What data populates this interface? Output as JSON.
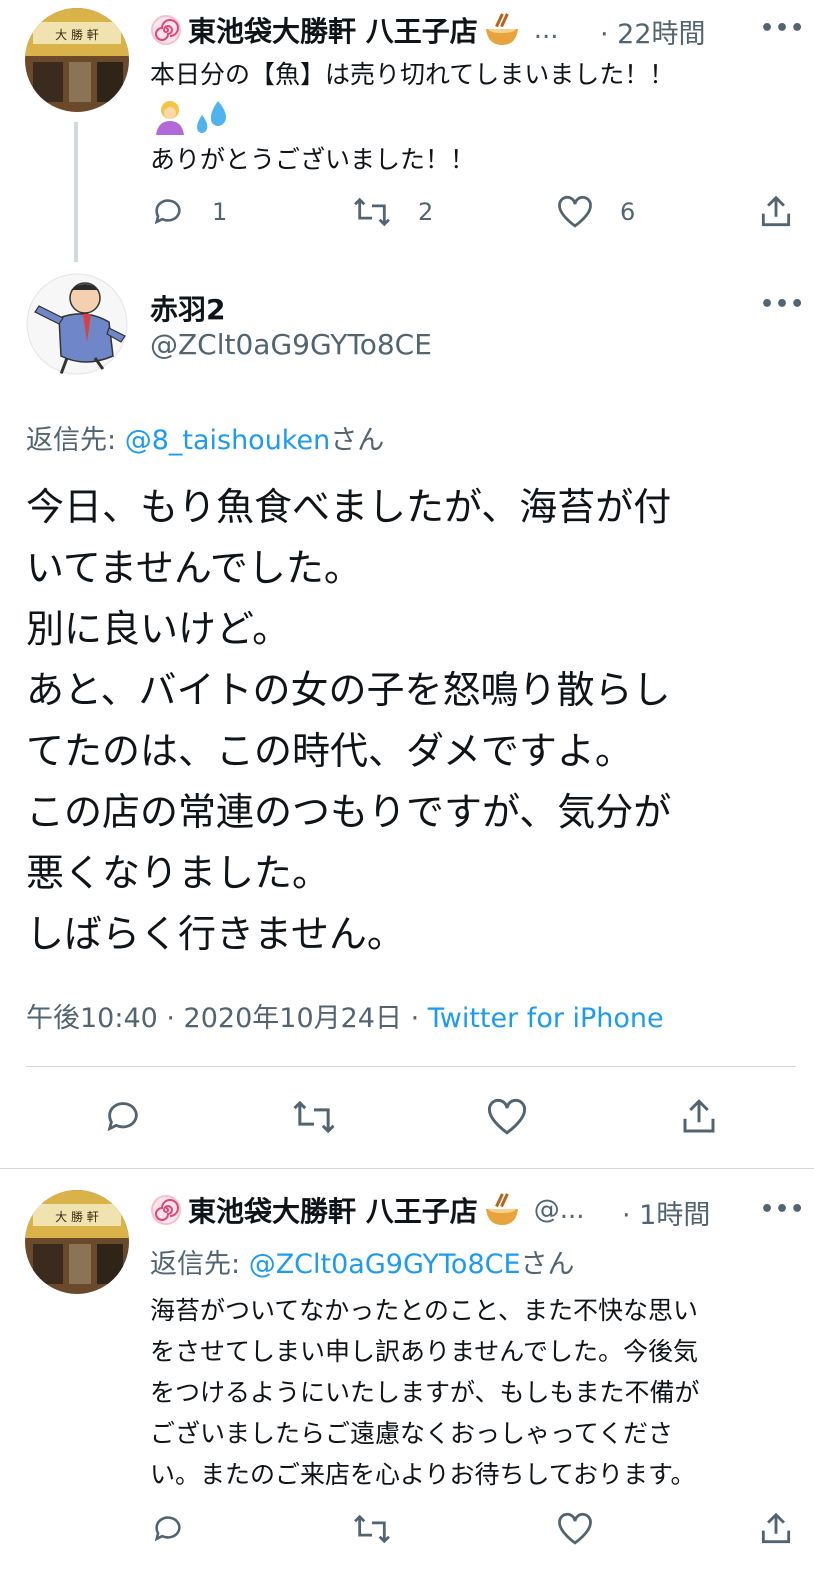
{
  "tweet1": {
    "display_name": "東池袋大勝軒 八王子店",
    "handle_ellipsis": "...",
    "time": "· 22時間",
    "text_line1": "本日分の【魚】は売り切れてしまいました！！",
    "text_line3": "ありがとうございました！！",
    "reply_count": "1",
    "retweet_count": "2",
    "like_count": "6"
  },
  "main": {
    "display_name": "赤羽2",
    "handle": "@ZClt0aG9GYTo8CE",
    "reply_to_prefix": "返信先: ",
    "reply_to_user": "@8_taishouken",
    "reply_to_suffix": "さん",
    "lines": [
      "今日、もり魚食べましたが、海苔が付",
      "いてませんでした。",
      "別に良いけど。",
      "あと、バイトの女の子を怒鳴り散らし",
      "てたのは、この時代、ダメですよ。",
      "この店の常連のつもりですが、気分が",
      "悪くなりました。",
      "しばらく行きません。"
    ],
    "timestamp": "午後10:40 · 2020年10月24日 · ",
    "client": "Twitter for iPhone"
  },
  "reply": {
    "display_name": "東池袋大勝軒 八王子店",
    "handle_ellipsis": "@...",
    "time": "· 1時間",
    "reply_to_prefix": "返信先: ",
    "reply_to_user": "@ZClt0aG9GYTo8CE",
    "reply_to_suffix": "さん",
    "lines": [
      "海苔がついてなかったとのこと、また不快な思い",
      "をさせてしまい申し訳ありませんでした。今後気",
      "をつけるようにいたしますが、もしもまた不備が",
      "ございましたらご遠慮なくおっしゃってくださ",
      "い。またのご来店を心よりお待ちしております。"
    ]
  },
  "more_label": "•••",
  "colors": {
    "text": "#0f1419",
    "muted": "#536471",
    "link": "#1d9bf0",
    "divider": "#cfd9de"
  },
  "icons": [
    "naruto-icon",
    "ramen-icon",
    "reply-icon",
    "retweet-icon",
    "like-icon",
    "share-icon",
    "more-icon",
    "bowing-person-emoji",
    "sweat-droplets-emoji"
  ]
}
